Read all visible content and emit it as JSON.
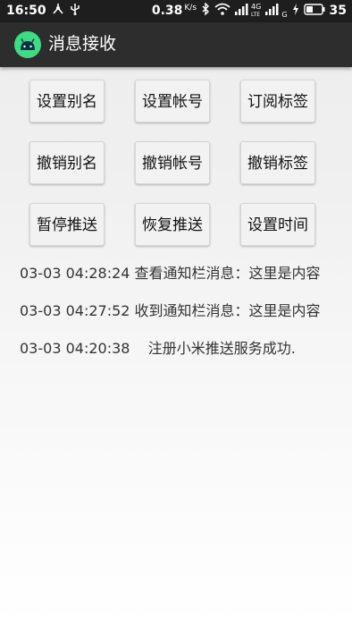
{
  "status_bar": {
    "time": "16:50",
    "speed": "0.38",
    "speed_unit": "K/s",
    "net_4g": "4G",
    "net_lte": "LTE",
    "net_g": "G",
    "battery": "35"
  },
  "toolbar": {
    "title": "消息接收",
    "icon": "android-icon"
  },
  "buttons": [
    {
      "label": "设置别名"
    },
    {
      "label": "设置帐号"
    },
    {
      "label": "订阅标签"
    },
    {
      "label": "撤销别名"
    },
    {
      "label": "撤销帐号"
    },
    {
      "label": "撤销标签"
    },
    {
      "label": "暂停推送"
    },
    {
      "label": "恢复推送"
    },
    {
      "label": "设置时间"
    }
  ],
  "logs": [
    {
      "text": "03-03 04:28:24 查看通知栏消息：这里是内容"
    },
    {
      "text": "03-03 04:27:52 收到通知栏消息：这里是内容"
    },
    {
      "text": "03-03 04:20:38    注册小米推送服务成功."
    }
  ],
  "colors": {
    "status_bar": "#1e1e1e",
    "toolbar": "#2d2d2d",
    "android_green": "#3ddc84"
  }
}
